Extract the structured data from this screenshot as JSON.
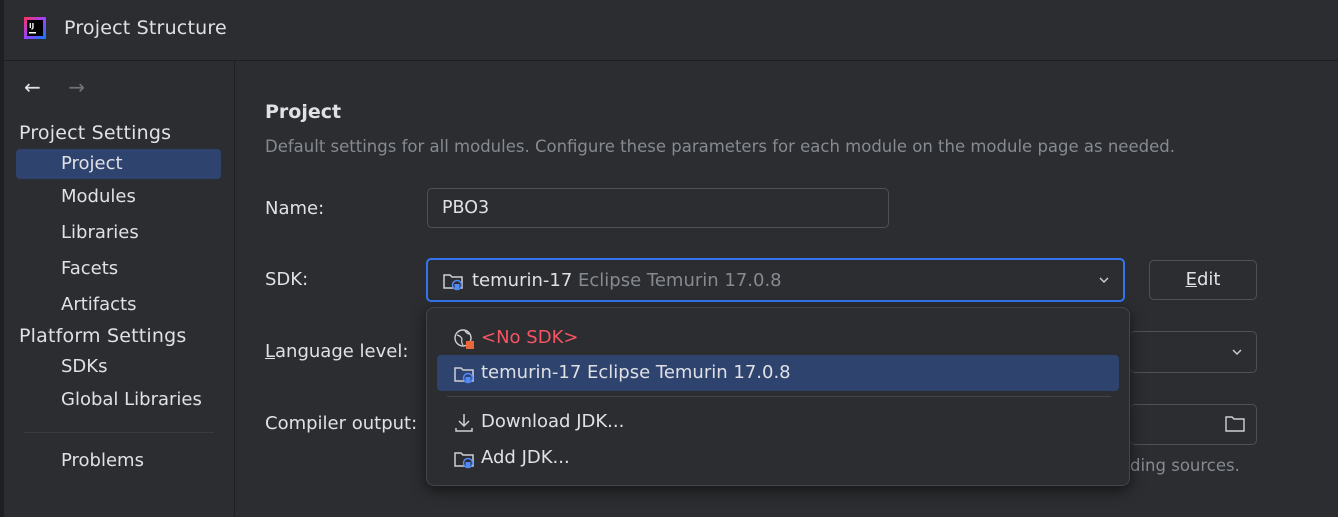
{
  "window": {
    "title": "Project Structure"
  },
  "nav": {
    "back": "←",
    "forward": "→"
  },
  "sidebar": {
    "project_settings_heading": "Project Settings",
    "project_items": [
      {
        "label": "Project"
      },
      {
        "label": "Modules"
      },
      {
        "label": "Libraries"
      },
      {
        "label": "Facets"
      },
      {
        "label": "Artifacts"
      }
    ],
    "platform_settings_heading": "Platform Settings",
    "platform_items": [
      {
        "label": "SDKs"
      },
      {
        "label": "Global Libraries"
      }
    ],
    "problems": "Problems",
    "selected_item": "Project"
  },
  "main": {
    "title": "Project",
    "description": "Default settings for all modules. Configure these parameters for each module on the module page as needed.",
    "name_label": "Name:",
    "name_value": "PBO3",
    "sdk_label": "SDK:",
    "sdk_name": "temurin-17",
    "sdk_detail": "Eclipse Temurin 17.0.8",
    "edit_button": {
      "mnemonic": "E",
      "rest": "dit"
    },
    "language_label": {
      "mnemonic": "L",
      "rest": "anguage level:"
    },
    "compiler_output_label": "Compiler output:",
    "compiler_hint": "ding sources."
  },
  "sdk_popup": {
    "items": [
      {
        "label": "<No SDK>",
        "icon": "globe-no-sdk-icon"
      },
      {
        "label": "temurin-17 Eclipse Temurin 17.0.8",
        "icon": "jdk-folder-icon",
        "selected": true
      },
      {
        "label": "Download JDK...",
        "icon": "download-icon"
      },
      {
        "label": "Add JDK...",
        "icon": "jdk-folder-icon"
      }
    ]
  },
  "colors": {
    "background": "#2b2d30",
    "selection": "#2e436e",
    "focus_border": "#3574f0",
    "error_text": "#f75464",
    "muted_text": "#868a91"
  }
}
